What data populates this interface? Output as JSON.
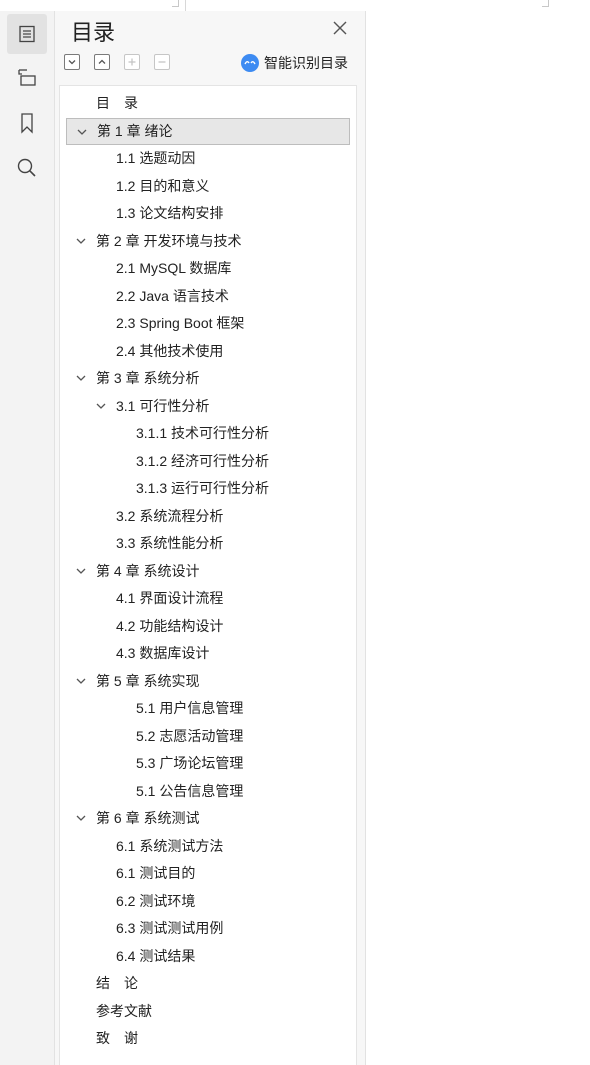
{
  "panel": {
    "title": "目录",
    "smart_label": "智能识别目录",
    "tools": [
      "expand-all-icon",
      "collapse-all-icon",
      "add-icon",
      "remove-icon"
    ]
  },
  "rail": [
    "toc-icon",
    "outline-icon",
    "bookmark-icon",
    "search-icon"
  ],
  "toc": [
    {
      "label": "目　录",
      "level": 0,
      "chev": false
    },
    {
      "label": "第 1 章  绪论",
      "level": 0,
      "chev": true,
      "selected": true
    },
    {
      "label": "1.1 选题动因",
      "level": 1
    },
    {
      "label": "1.2 目的和意义",
      "level": 1
    },
    {
      "label": "1.3 论文结构安排",
      "level": 1
    },
    {
      "label": "第 2 章  开发环境与技术",
      "level": 0,
      "chev": true
    },
    {
      "label": "2.1 MySQL 数据库",
      "level": 1
    },
    {
      "label": "2.2 Java 语言技术",
      "level": 1
    },
    {
      "label": "2.3 Spring Boot 框架",
      "level": 1
    },
    {
      "label": "2.4  其他技术使用",
      "level": 1
    },
    {
      "label": "第 3 章  系统分析",
      "level": 0,
      "chev": true
    },
    {
      "label": "3.1 可行性分析",
      "level": 1,
      "chev": true
    },
    {
      "label": "3.1.1 技术可行性分析",
      "level": 2
    },
    {
      "label": "3.1.2 经济可行性分析",
      "level": 2
    },
    {
      "label": "3.1.3 运行可行性分析",
      "level": 2
    },
    {
      "label": "3.2 系统流程分析",
      "level": 1
    },
    {
      "label": "3.3 系统性能分析",
      "level": 1
    },
    {
      "label": "第 4 章  系统设计",
      "level": 0,
      "chev": true
    },
    {
      "label": "4.1 界面设计流程",
      "level": 1
    },
    {
      "label": "4.2 功能结构设计",
      "level": 1
    },
    {
      "label": "4.3 数据库设计",
      "level": 1
    },
    {
      "label": "第 5 章  系统实现",
      "level": 0,
      "chev": true
    },
    {
      "label": "5.1 用户信息管理",
      "level": 2
    },
    {
      "label": "5.2  志愿活动管理",
      "level": 2
    },
    {
      "label": "5.3 广场论坛管理",
      "level": 2
    },
    {
      "label": "5.1 公告信息管理",
      "level": 2
    },
    {
      "label": "第 6 章  系统测试",
      "level": 0,
      "chev": true
    },
    {
      "label": "6.1  系统测试方法",
      "level": 1
    },
    {
      "label": "6.1 测试目的",
      "level": 1
    },
    {
      "label": "6.2 测试环境",
      "level": 1
    },
    {
      "label": "6.3 测试测试用例",
      "level": 1
    },
    {
      "label": "6.4 测试结果",
      "level": 1
    },
    {
      "label": "结　论",
      "level": 0
    },
    {
      "label": "参考文献",
      "level": 0
    },
    {
      "label": "致　谢",
      "level": 0
    }
  ]
}
